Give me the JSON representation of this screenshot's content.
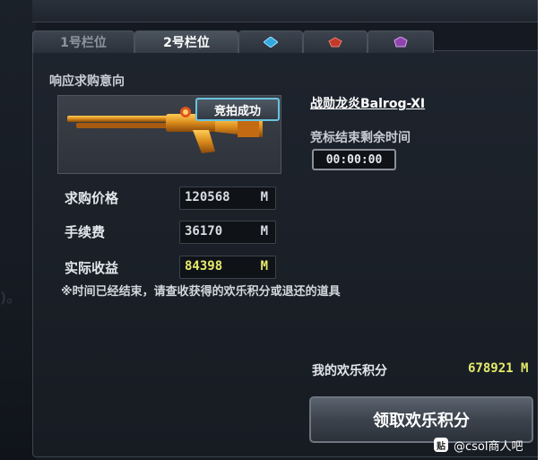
{
  "tabs": [
    {
      "label": "1号栏位",
      "active": false
    },
    {
      "label": "2号栏位",
      "active": true
    },
    {
      "icon": "blue-gem-icon",
      "color": "#35a8e0"
    },
    {
      "icon": "red-gem-icon",
      "color": "#c0392b"
    },
    {
      "icon": "purple-gem-icon",
      "color": "#8e44ad"
    }
  ],
  "section_title": "响应求购意向",
  "badge": "竞拍成功",
  "item": {
    "name": "战勋龙炎Balrog-XI",
    "timer_label": "竞标结束剩余时间",
    "timer": "00:00:00"
  },
  "fields": [
    {
      "label": "求购价格",
      "value": "120568",
      "unit": "M"
    },
    {
      "label": "手续费",
      "value": "36170",
      "unit": "M"
    },
    {
      "label": "实际收益",
      "value": "84398",
      "unit": "M"
    }
  ],
  "notice": "※时间已经结束，请查收获得的欢乐积分或退还的道具",
  "points": {
    "label": "我的欢乐积分",
    "value": "678921 M"
  },
  "claim_button": "领取欢乐积分",
  "watermark": {
    "icon": "贴",
    "text": "@csol商人吧"
  },
  "colors": {
    "highlight": "#e7ea6a",
    "badge_border": "#68c4e0",
    "weapon_gold": "#d98a1c"
  }
}
